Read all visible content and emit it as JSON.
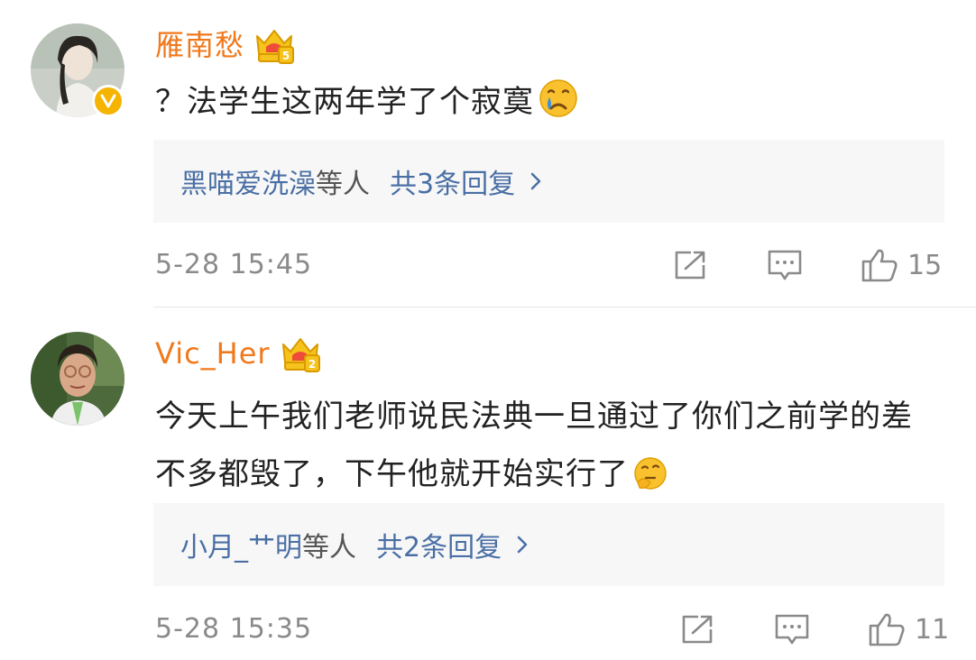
{
  "comments": [
    {
      "username": "雁南愁",
      "text": "？法学生这两年学了个寂寞",
      "replies": {
        "users": "黑喵爱洗澡",
        "suffix": "等人",
        "count_label": "共3条回复"
      },
      "timestamp": "5-28 15:45",
      "likes": "15",
      "emoji": "crying-face-icon",
      "verified": true
    },
    {
      "username": "Vic_Her",
      "text": "今天上午我们老师说民法典一旦通过了你们之前学的差不多都毁了，下午他就开始实行了",
      "replies": {
        "users": "小月_艹明",
        "suffix": "等人",
        "count_label": "共2条回复"
      },
      "timestamp": "5-28 15:35",
      "likes": "11",
      "emoji": "thinking-face-icon",
      "verified": false
    }
  ],
  "colors": {
    "username": "#f0791c",
    "reply_link": "#4a6fa5",
    "meta_gray": "#8a8a8a",
    "reply_bg": "#f7f7f7",
    "badge_gold": "#f5b400"
  },
  "icons": [
    "crown-level-icon",
    "verified-v-icon",
    "share-icon",
    "comment-icon",
    "like-icon",
    "chevron-right-icon"
  ]
}
